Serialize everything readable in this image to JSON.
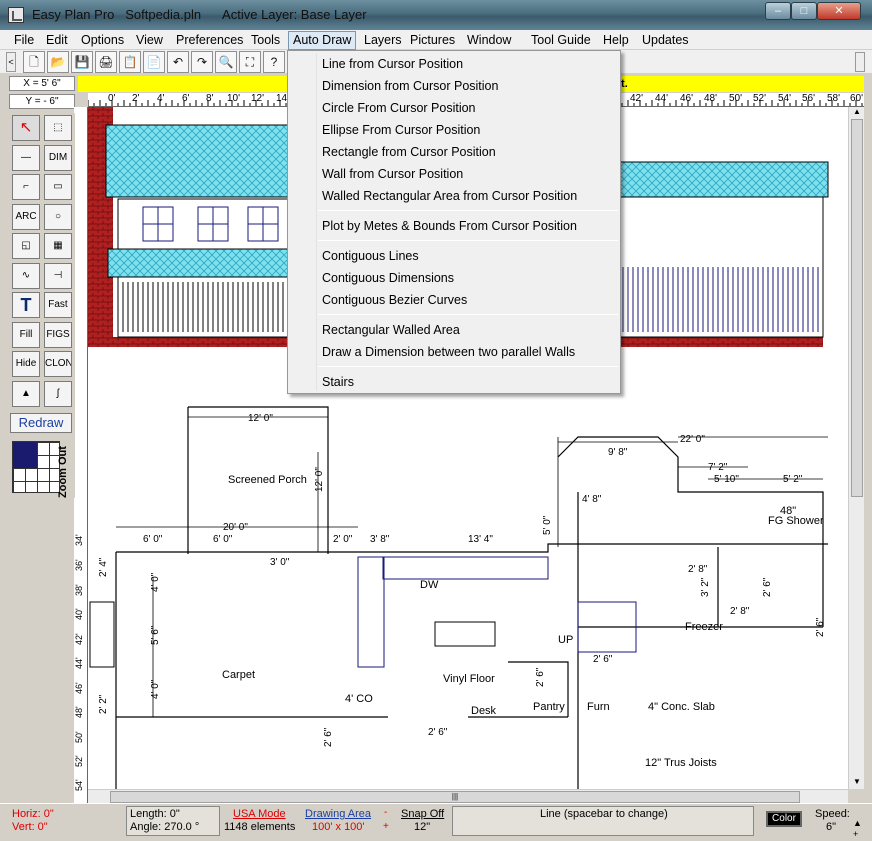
{
  "window": {
    "title": "Easy Plan Pro   Softpedia.pln      Active Layer: Base Layer",
    "buttons": {
      "minimize": "–",
      "maximize": "□",
      "close": "✕"
    }
  },
  "menubar": {
    "items": [
      "File",
      "Edit",
      "Options",
      "View",
      "Preferences",
      "Tools",
      "Auto Draw",
      "Layers",
      "Pictures",
      "Window",
      "Tool Guide",
      "Help",
      "Updates"
    ],
    "active": "Auto Draw"
  },
  "toolbar": {
    "icons": [
      "new-file-icon",
      "open-folder-icon",
      "save-icon",
      "print-icon",
      "clipboard-icon",
      "paste-icon",
      "undo-icon",
      "redo-icon",
      "zoom-icon",
      "zoom-fit-icon",
      "help-icon"
    ],
    "glyphs": [
      "🗋",
      "📂",
      "💾",
      "🖨",
      "📋",
      "📄",
      "↶",
      "↷",
      "🔍",
      "⛶",
      "?"
    ]
  },
  "coords": {
    "x": "X = 5' 6\"",
    "y": "Y = - 6\""
  },
  "tip_bar": {
    "text": "it."
  },
  "ruler": {
    "h_labels": [
      "0'",
      "2'",
      "4'",
      "6'",
      "8'",
      "10'",
      "12'",
      "14'",
      "42'",
      "44'",
      "46'",
      "48'",
      "50'",
      "52'",
      "54'",
      "56'",
      "58'",
      "60'",
      "62'"
    ],
    "v_labels": [
      "34'",
      "36'",
      "38'",
      "40'",
      "42'",
      "44'",
      "46'",
      "48'",
      "50'",
      "52'",
      "54'",
      "56'"
    ]
  },
  "palette": {
    "buttons": [
      {
        "name": "select-arrow-icon",
        "glyph": "↖"
      },
      {
        "name": "select-area-icon",
        "glyph": "⬚"
      },
      {
        "name": "line-tool-icon",
        "glyph": "—"
      },
      {
        "name": "dimension-tool",
        "glyph": "DIM"
      },
      {
        "name": "polyline-tool-icon",
        "glyph": "⌐"
      },
      {
        "name": "rectangle-tool-icon",
        "glyph": "▭"
      },
      {
        "name": "arc-tool",
        "glyph": "ARC"
      },
      {
        "name": "circle-tool-icon",
        "glyph": "○"
      },
      {
        "name": "wall-corner-icon",
        "glyph": "◱"
      },
      {
        "name": "window-tool-icon",
        "glyph": "▦"
      },
      {
        "name": "curve-tool-icon",
        "glyph": "∿"
      },
      {
        "name": "door-tool-icon",
        "glyph": "⊣"
      },
      {
        "name": "text-tool-icon",
        "glyph": "T"
      },
      {
        "name": "fast-text-tool",
        "glyph": "Fast"
      },
      {
        "name": "fill-tool",
        "glyph": "Fill"
      },
      {
        "name": "figs-tool",
        "glyph": "FIGS"
      },
      {
        "name": "hide-tool",
        "glyph": "Hide"
      },
      {
        "name": "clone-tool",
        "glyph": "CLONE"
      },
      {
        "name": "landscape-tool-icon",
        "glyph": "▲"
      },
      {
        "name": "freehand-tool-icon",
        "glyph": "ʃ"
      }
    ],
    "redraw": "Redraw",
    "zoom_out": "Zoom Out"
  },
  "auto_draw_menu": {
    "groups": [
      [
        "Line from Cursor Position",
        "Dimension from Cursor Position",
        "Circle From Cursor Position",
        "Ellipse From Cursor Position",
        "Rectangle from Cursor Position",
        "Wall from Cursor Position",
        "Walled Rectangular Area from Cursor Position"
      ],
      [
        "Plot by Metes & Bounds From Cursor Position"
      ],
      [
        "Contiguous Lines",
        "Contiguous Dimensions",
        "Contiguous Bezier Curves"
      ],
      [
        "Rectangular Walled Area",
        "Draw a Dimension between two parallel Walls"
      ],
      [
        "Stairs"
      ]
    ]
  },
  "plan_labels": {
    "dims": [
      "12' 0\"",
      "12' 0\"",
      "20' 0\"",
      "6' 0\"",
      "6' 0\"",
      "2' 0\"",
      "3' 8\"",
      "13' 4\"",
      "5' 0\"",
      "9' 8\"",
      "22' 0\"",
      "7' 2\"",
      "5' 10\"",
      "5' 2\"",
      "4' 8\"",
      "4' 0\"",
      "5' 6\"",
      "4' 0\"",
      "2' 4\"",
      "2' 2\"",
      "3' 0\"",
      "2' 6\"",
      "2' 8\"",
      "3' 2\"",
      "2' 8\"",
      "2' 6\"",
      "2' 6\"",
      "2' 6\"",
      "2' 6\"",
      "2' 6\""
    ],
    "rooms": [
      "Screened Porch",
      "Carpet",
      "DW",
      "Vinyl Floor",
      "4' CO",
      "UP",
      "Desk",
      "Pantry",
      "Furn",
      "4\" Conc. Slab",
      "12\" Trus Joists",
      "Freezer",
      "FG Shower",
      "48\""
    ]
  },
  "status": {
    "horiz": "Horiz: 0\"",
    "vert": "Vert: 0\"",
    "length": "Length:  0\"",
    "angle": "Angle:  270.0 °",
    "usa_mode": "USA Mode",
    "elements": "1148 elements",
    "drawing_area": "Drawing Area",
    "area_size": "100' x 100'",
    "snap_off": "Snap Off",
    "snap_value": "12\"",
    "mode": "Line  (spacebar to change)",
    "color": "Color",
    "speed_label": "Speed:",
    "speed_value": "6\""
  }
}
